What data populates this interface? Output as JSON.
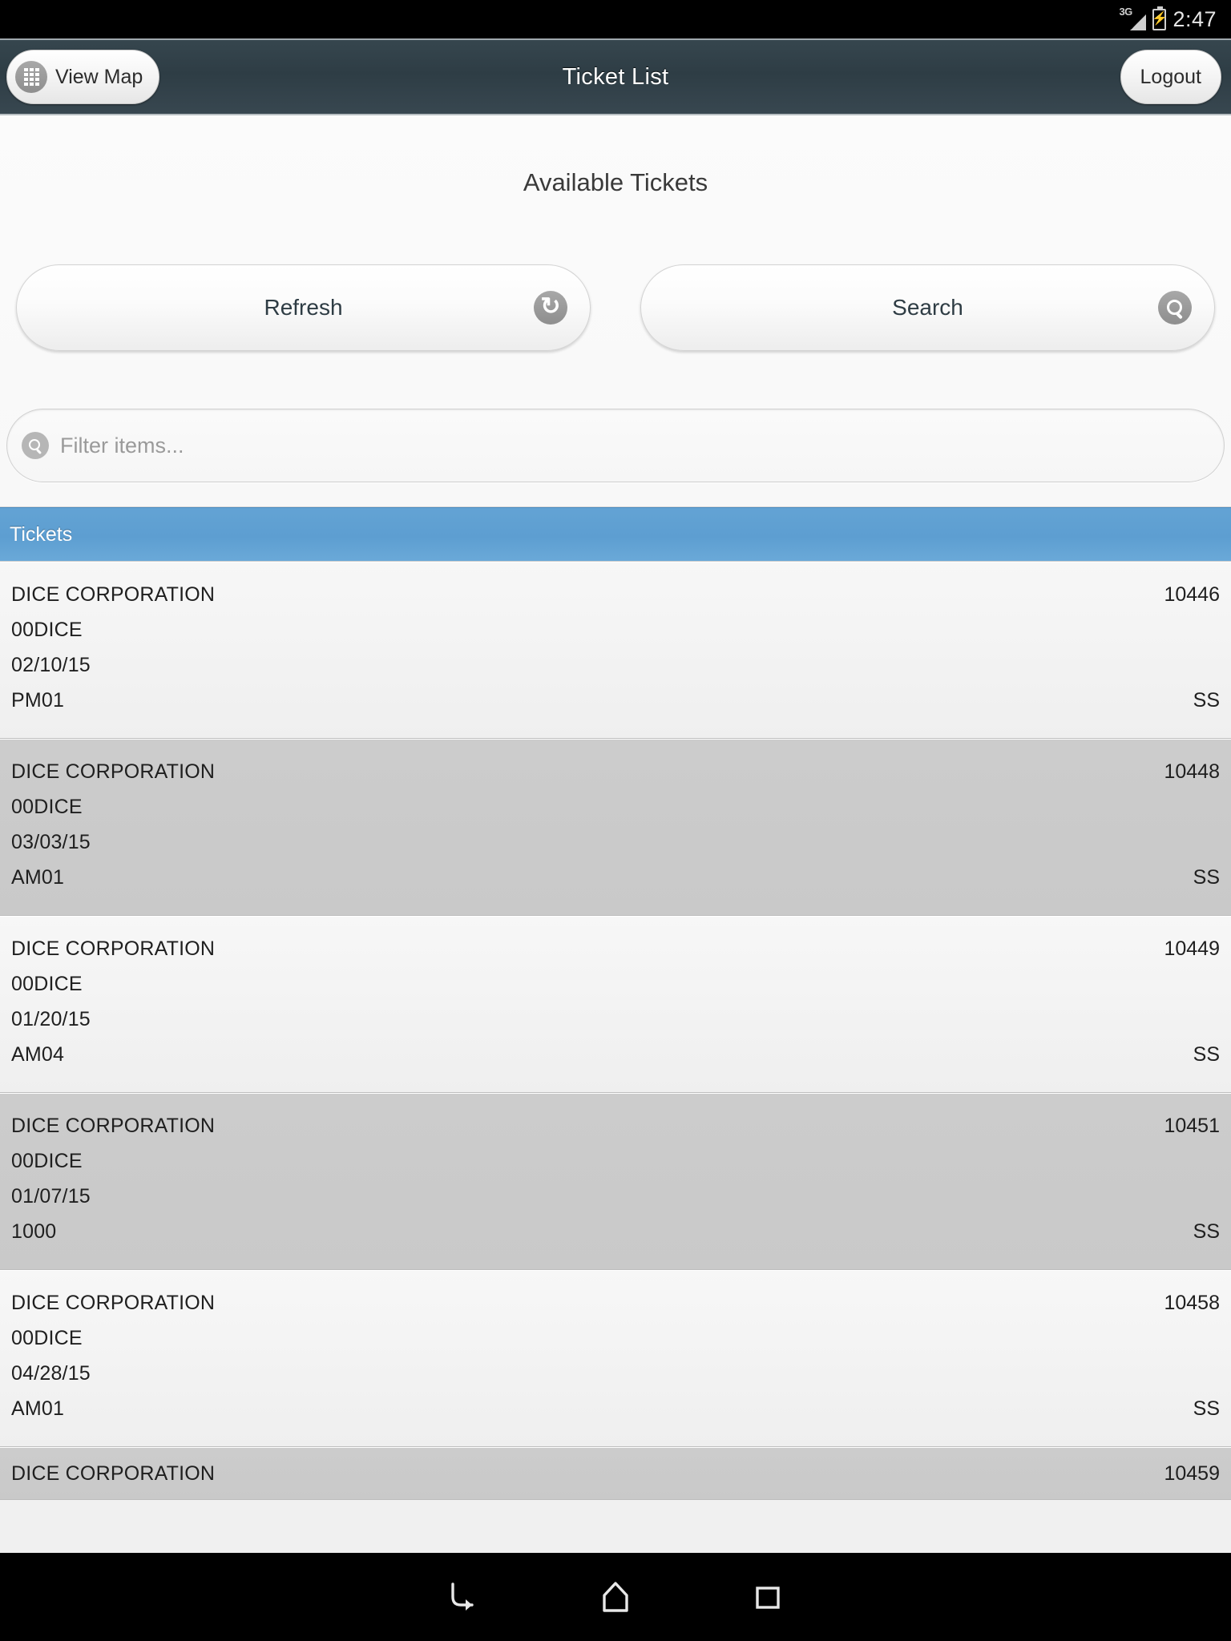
{
  "statusbar": {
    "network_label": "3G",
    "clock": "2:47",
    "battery_icon": "battery-charging-icon",
    "signal_icon": "signal-bars-icon"
  },
  "titlebar": {
    "title": "Ticket List",
    "view_map_label": "View Map",
    "view_map_icon": "grid-map-icon",
    "logout_label": "Logout"
  },
  "main": {
    "heading": "Available Tickets",
    "refresh_label": "Refresh",
    "refresh_icon": "refresh-icon",
    "search_label": "Search",
    "search_icon": "search-icon",
    "filter_placeholder": "Filter items...",
    "filter_value": "",
    "filter_icon": "search-icon",
    "list_header": "Tickets"
  },
  "colors": {
    "accent_blue": "#5d9ed1",
    "titlebar_dark": "#2e3d45",
    "row_alt": "#cccccc",
    "row_base": "#f4f4f4"
  },
  "tickets": [
    {
      "customer": "DICE CORPORATION",
      "account": "00DICE",
      "date": "02/10/15",
      "code": "PM01",
      "number": "10446",
      "status": "SS"
    },
    {
      "customer": "DICE CORPORATION",
      "account": "00DICE",
      "date": "03/03/15",
      "code": "AM01",
      "number": "10448",
      "status": "SS"
    },
    {
      "customer": "DICE CORPORATION",
      "account": "00DICE",
      "date": "01/20/15",
      "code": "AM04",
      "number": "10449",
      "status": "SS"
    },
    {
      "customer": "DICE CORPORATION",
      "account": "00DICE",
      "date": "01/07/15",
      "code": "1000",
      "number": "10451",
      "status": "SS"
    },
    {
      "customer": "DICE CORPORATION",
      "account": "00DICE",
      "date": "04/28/15",
      "code": "AM01",
      "number": "10458",
      "status": "SS"
    }
  ],
  "partial_ticket": {
    "customer": "DICE CORPORATION",
    "number": "10459"
  },
  "navbar": {
    "back_icon": "back-arrow-icon",
    "home_icon": "home-icon",
    "recents_icon": "recent-apps-icon"
  }
}
